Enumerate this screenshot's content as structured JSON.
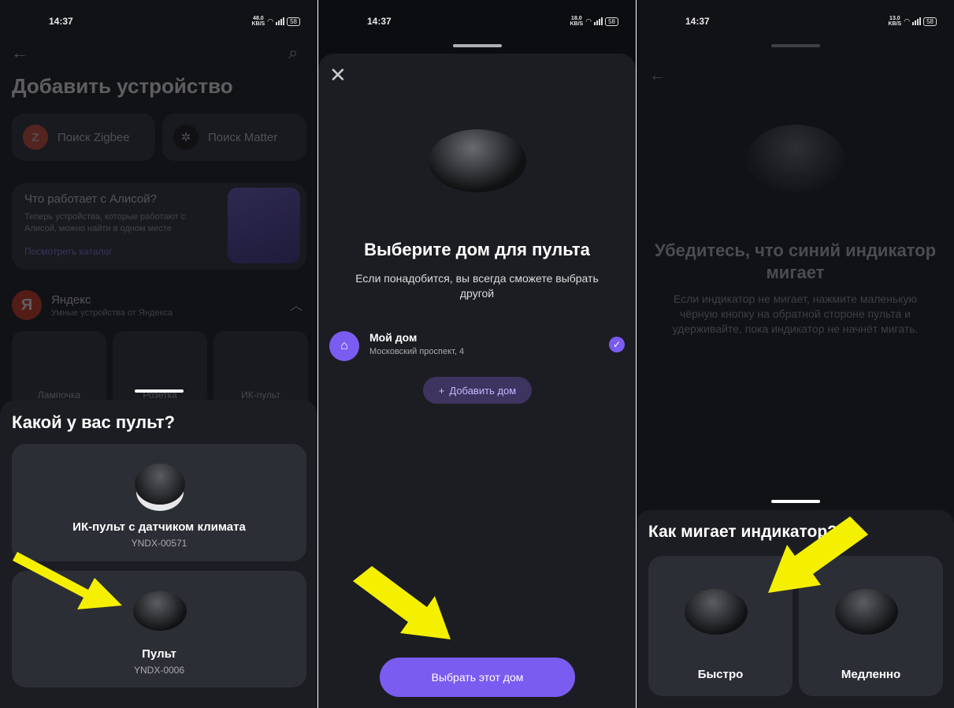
{
  "status": {
    "time": "14:37",
    "speed1": "48.0",
    "speed2": "18.0",
    "speed3": "13.0",
    "speed_unit": "KB/S",
    "battery": "58"
  },
  "panel1": {
    "title": "Добавить устройство",
    "zigbee_label": "Поиск Zigbee",
    "matter_label": "Поиск Matter",
    "promo": {
      "title": "Что работает с Алисой?",
      "desc": "Теперь устройства, которые работают с Алисой, можно найти в одном месте",
      "link": "Посмотреть каталог"
    },
    "brand": {
      "name": "Яндекс",
      "sub": "Умные устройства от Яндекса"
    },
    "tiles": [
      "Лампочка",
      "Розетка",
      "ИК-пульт"
    ],
    "sheet": {
      "title": "Какой у вас пульт?",
      "cards": [
        {
          "name": "ИК-пульт с датчиком климата",
          "model": "YNDX-00571"
        },
        {
          "name": "Пульт",
          "model": "YNDX-0006"
        }
      ]
    }
  },
  "panel2": {
    "title": "Выберите дом для пульта",
    "subtitle": "Если понадобится, вы всегда сможете выбрать другой",
    "home": {
      "name": "Мой дом",
      "address": "Московский проспект, 4"
    },
    "add_home": "Добавить дом",
    "primary": "Выбрать этот дом"
  },
  "panel3": {
    "title": "Убедитесь, что синий индикатор мигает",
    "desc": "Если индикатор не мигает, нажмите маленькую чёрную кнопку на обратной стороне пульта и удерживайте, пока индикатор не начнёт мигать.",
    "sheet": {
      "title": "Как мигает индикатор?",
      "options": [
        "Быстро",
        "Медленно"
      ]
    }
  },
  "colors": {
    "accent": "#7a5cf0",
    "arrow": "#f4f000",
    "background": "#111216",
    "card": "#2c2e36"
  }
}
